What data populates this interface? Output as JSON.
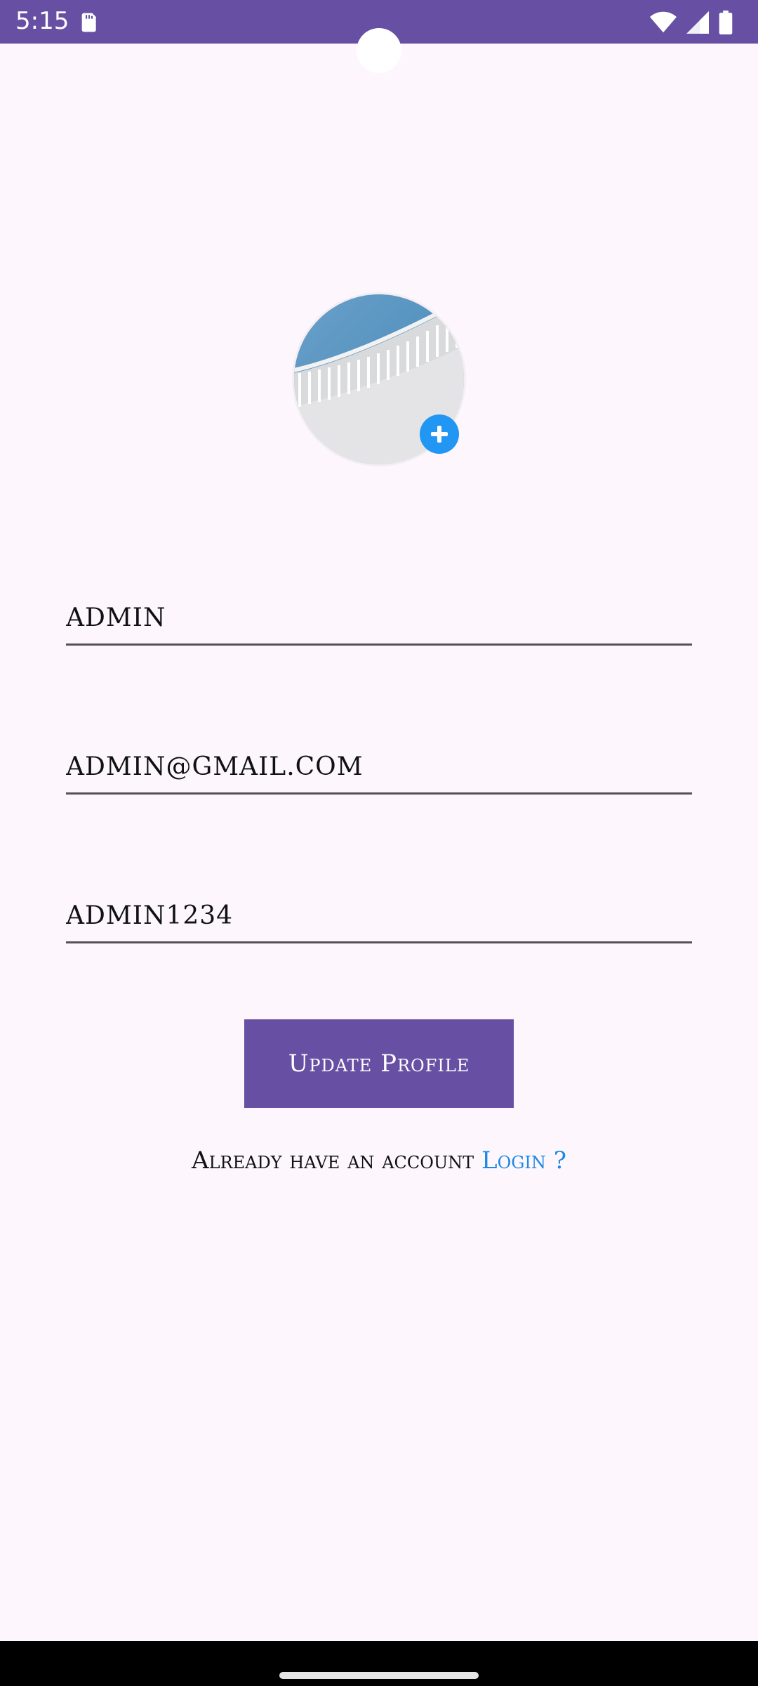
{
  "status_bar": {
    "time": "5:15",
    "icons": [
      "sd-card-icon",
      "wifi-icon",
      "signal-icon",
      "battery-icon"
    ]
  },
  "profile": {
    "avatar_icon": "profile-photo",
    "add_photo_icon": "plus-icon"
  },
  "form": {
    "name_value": "admin",
    "email_value": "admin@gmail.com",
    "password_value": "admin1234"
  },
  "actions": {
    "update_label": "Update Profile",
    "login_prompt": "Already have an account",
    "login_link": "Login ?"
  },
  "colors": {
    "primary": "#6750a4",
    "accent": "#2196f3",
    "link": "#1e88e5",
    "background": "#fdf7fd"
  }
}
